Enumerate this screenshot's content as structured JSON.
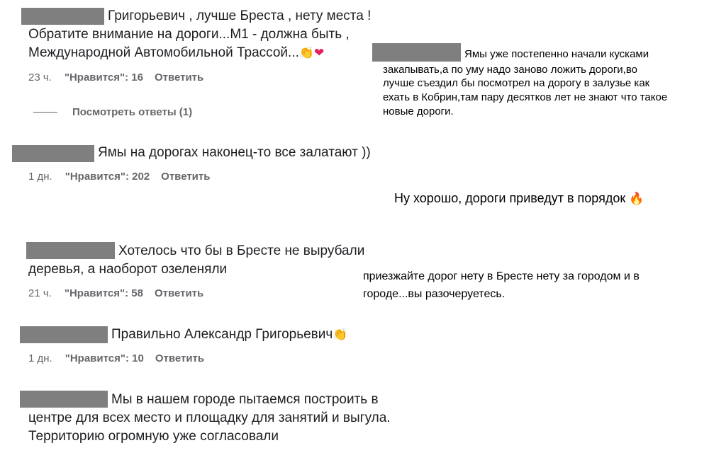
{
  "comments": [
    {
      "lines": [
        "Григорьевич , лучше Бреста , нету места !",
        "Обратите внимание на дороги...М1 - должна быть ,",
        "Международной Автомобильной Трассой..."
      ],
      "time": "23 ч.",
      "likes": "\"Нравится\": 16",
      "reply": "Ответить",
      "view_replies": "Посмотреть ответы (1)"
    },
    {
      "lines": [
        "Ямы на дорогах наконец-то все залатают ))"
      ],
      "time": "1 дн.",
      "likes": "\"Нравится\": 202",
      "reply": "Ответить"
    },
    {
      "lines": [
        "Хотелось что бы в Бресте не вырубали",
        "деревья, а наоборот озеленяли"
      ],
      "time": "21 ч.",
      "likes": "\"Нравится\": 58",
      "reply": "Ответить"
    },
    {
      "lines": [
        "Правильно Александр Григорьевич"
      ],
      "time": "1 дн.",
      "likes": "\"Нравится\": 10",
      "reply": "Ответить"
    },
    {
      "lines": [
        "Мы в нашем городе пытаемся построить в",
        "центре для всех место и площадку для занятий и выгула.",
        "Территорию огромную уже согласовали"
      ]
    }
  ],
  "annotations": [
    {
      "lines": [
        "Ямы уже постепенно начали кусками",
        "закапывать,а по уму надо заново ложить дороги,во",
        "лучше съездил бы посмотрел на дорогу в залузье как",
        "ехать в Кобрин,там пару десятков лет не знают что такое",
        "новые дороги."
      ]
    },
    {
      "lines": [
        "Ну хорошо, дороги приведут в порядок"
      ]
    },
    {
      "lines": [
        "приезжайте дорог нету в Бресте нету за городом и в",
        "городе...вы разочеруетесь."
      ]
    }
  ],
  "icons": {
    "clap": "clapping-hands-emoji",
    "heart": "red-heart-emoji",
    "fire": "fire-emoji"
  },
  "colors": {
    "redaction": "#7f7f7f",
    "meta_text": "#65676b",
    "body_text": "#1c1e21"
  }
}
